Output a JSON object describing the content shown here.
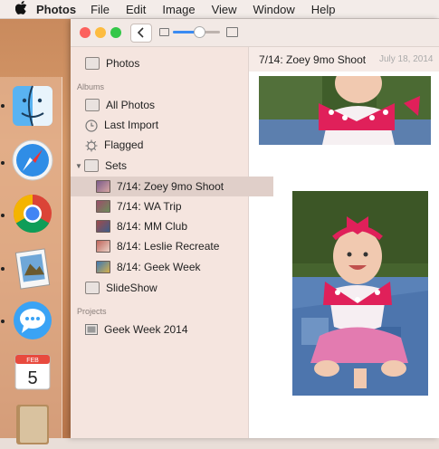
{
  "menubar": {
    "app": "Photos",
    "items": [
      "File",
      "Edit",
      "Image",
      "View",
      "Window",
      "Help"
    ]
  },
  "dock": {
    "calendar_month": "FEB",
    "calendar_day": "5"
  },
  "sidebar": {
    "photos": "Photos",
    "albums_header": "Albums",
    "all_photos": "All Photos",
    "last_import": "Last Import",
    "flagged": "Flagged",
    "sets": "Sets",
    "set_items": [
      "7/14: Zoey 9mo Shoot",
      "7/14: WA Trip",
      "8/14: MM Club",
      "8/14: Leslie Recreate",
      "8/14: Geek Week"
    ],
    "slideshow": "SlideShow",
    "projects_header": "Projects",
    "project_item": "Geek Week 2014"
  },
  "content": {
    "title": "7/14: Zoey 9mo Shoot",
    "date": "July 18, 2014"
  },
  "toolbar": {
    "zoom_level": 0.55
  },
  "colors": {
    "selection": "#e0cfc9",
    "close": "#fc615d",
    "minimize": "#fdbc40",
    "zoom": "#34c749",
    "accent": "#3a8bf2"
  }
}
